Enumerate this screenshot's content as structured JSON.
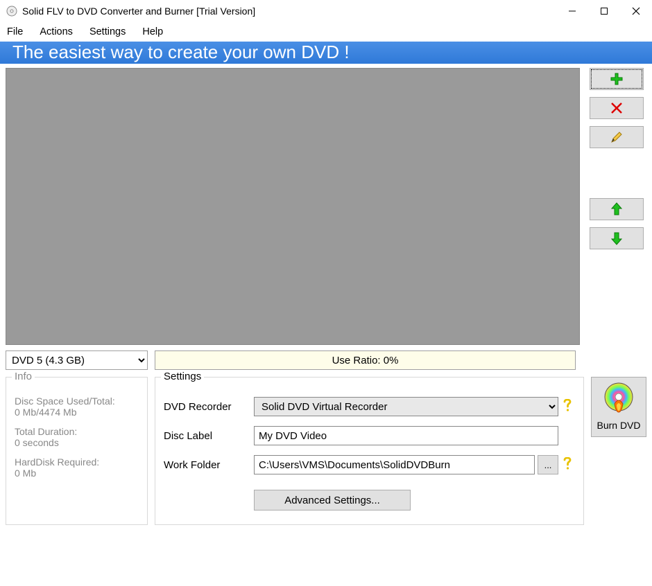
{
  "window": {
    "title": "Solid FLV to DVD Converter and Burner [Trial Version]"
  },
  "menubar": {
    "file": "File",
    "actions": "Actions",
    "settings": "Settings",
    "help": "Help"
  },
  "banner": "The easiest way to create your own DVD !",
  "disc_select": "DVD 5  (4.3 GB)",
  "use_ratio": "Use Ratio: 0%",
  "info": {
    "title": "Info",
    "space_label": "Disc Space Used/Total:",
    "space_value": "0 Mb/4474 Mb",
    "duration_label": "Total Duration:",
    "duration_value": "0 seconds",
    "hd_label": "HardDisk Required:",
    "hd_value": "0 Mb"
  },
  "settings": {
    "title": "Settings",
    "recorder_label": "DVD Recorder",
    "recorder_value": "Solid DVD Virtual Recorder",
    "label_label": "Disc Label",
    "label_value": "My DVD Video",
    "folder_label": "Work Folder",
    "folder_value": "C:\\Users\\VMS\\Documents\\SolidDVDBurn",
    "browse": "...",
    "advanced": "Advanced Settings..."
  },
  "burn": {
    "label": "Burn DVD"
  }
}
